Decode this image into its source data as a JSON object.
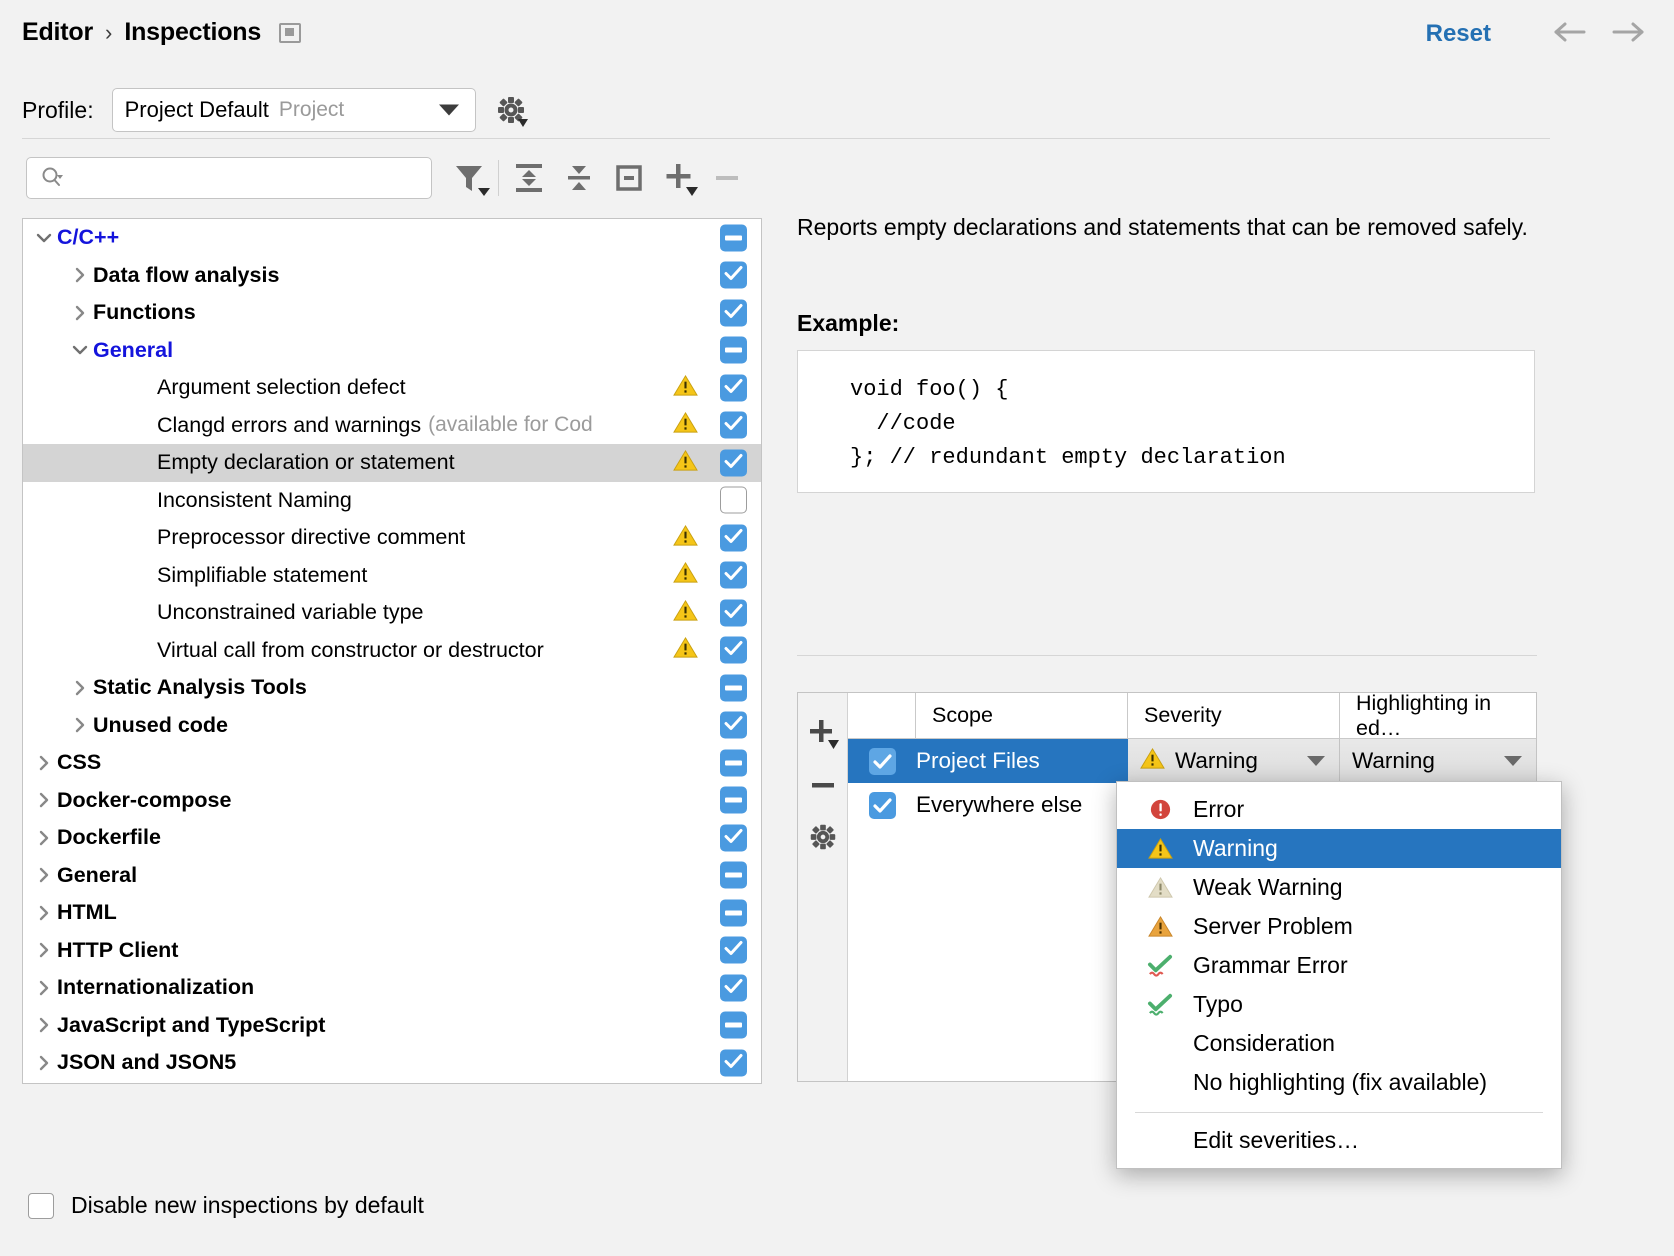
{
  "header": {
    "breadcrumb": [
      "Editor",
      "Inspections"
    ],
    "separator": "›",
    "reset_label": "Reset",
    "back_icon": "arrow-left-icon",
    "forward_icon": "arrow-right-icon",
    "settings_badge_icon": "window-panel-icon"
  },
  "profile": {
    "label": "Profile:",
    "value": "Project Default",
    "suffix": "Project",
    "gear_icon": "gear-dropdown-icon"
  },
  "search": {
    "placeholder": "",
    "value": "",
    "icon": "search-icon"
  },
  "toolbar": [
    {
      "name": "filter-icon",
      "tooltip": "Filter inspections"
    },
    {
      "name": "expand-all-icon",
      "tooltip": "Expand all"
    },
    {
      "name": "collapse-all-icon",
      "tooltip": "Collapse all"
    },
    {
      "name": "expand-selection-icon",
      "tooltip": "Expand selection"
    },
    {
      "name": "add-icon",
      "tooltip": "Add"
    },
    {
      "name": "remove-icon",
      "tooltip": "Remove"
    }
  ],
  "tree": {
    "rows": [
      {
        "label": "C/C++",
        "indent": 0,
        "twisty": "down",
        "style": "blue",
        "check": "partial",
        "warn": false
      },
      {
        "label": "Data flow analysis",
        "indent": 1,
        "twisty": "right",
        "style": "group",
        "check": "on",
        "warn": false
      },
      {
        "label": "Functions",
        "indent": 1,
        "twisty": "right",
        "style": "group",
        "check": "on",
        "warn": false
      },
      {
        "label": "General",
        "indent": 1,
        "twisty": "down",
        "style": "blue",
        "check": "partial",
        "warn": false
      },
      {
        "label": "Argument selection defect",
        "indent": 2,
        "twisty": "none",
        "style": "leaf",
        "check": "on",
        "warn": true
      },
      {
        "label": "Clangd errors and warnings",
        "sub": "(available for Cod",
        "indent": 2,
        "twisty": "none",
        "style": "leaf",
        "check": "on",
        "warn": true
      },
      {
        "label": "Empty declaration or statement",
        "indent": 2,
        "twisty": "none",
        "style": "leaf",
        "check": "on",
        "warn": true,
        "selected": true
      },
      {
        "label": "Inconsistent Naming",
        "indent": 2,
        "twisty": "none",
        "style": "leaf",
        "check": "off",
        "warn": false
      },
      {
        "label": "Preprocessor directive comment",
        "indent": 2,
        "twisty": "none",
        "style": "leaf",
        "check": "on",
        "warn": true
      },
      {
        "label": "Simplifiable statement",
        "indent": 2,
        "twisty": "none",
        "style": "leaf",
        "check": "on",
        "warn": true
      },
      {
        "label": "Unconstrained variable type",
        "indent": 2,
        "twisty": "none",
        "style": "leaf",
        "check": "on",
        "warn": true
      },
      {
        "label": "Virtual call from constructor or destructor",
        "indent": 2,
        "twisty": "none",
        "style": "leaf",
        "check": "on",
        "warn": true
      },
      {
        "label": "Static Analysis Tools",
        "indent": 1,
        "twisty": "right",
        "style": "group",
        "check": "partial",
        "warn": false
      },
      {
        "label": "Unused code",
        "indent": 1,
        "twisty": "right",
        "style": "group",
        "check": "on",
        "warn": false
      },
      {
        "label": "CSS",
        "indent": 0,
        "twisty": "right",
        "style": "group",
        "check": "partial",
        "warn": false
      },
      {
        "label": "Docker-compose",
        "indent": 0,
        "twisty": "right",
        "style": "group",
        "check": "partial",
        "warn": false
      },
      {
        "label": "Dockerfile",
        "indent": 0,
        "twisty": "right",
        "style": "group",
        "check": "on",
        "warn": false
      },
      {
        "label": "General",
        "indent": 0,
        "twisty": "right",
        "style": "group",
        "check": "partial",
        "warn": false
      },
      {
        "label": "HTML",
        "indent": 0,
        "twisty": "right",
        "style": "group",
        "check": "partial",
        "warn": false
      },
      {
        "label": "HTTP Client",
        "indent": 0,
        "twisty": "right",
        "style": "group",
        "check": "on",
        "warn": false
      },
      {
        "label": "Internationalization",
        "indent": 0,
        "twisty": "right",
        "style": "group",
        "check": "on",
        "warn": false
      },
      {
        "label": "JavaScript and TypeScript",
        "indent": 0,
        "twisty": "right",
        "style": "group",
        "check": "partial",
        "warn": false
      },
      {
        "label": "JSON and JSON5",
        "indent": 0,
        "twisty": "right",
        "style": "group",
        "check": "on",
        "warn": false
      },
      {
        "label": "",
        "indent": 0,
        "twisty": "right",
        "style": "group",
        "check": "partial",
        "warn": false
      }
    ]
  },
  "bottom": {
    "disable_new_label": "Disable new inspections by default",
    "disable_new_checked": false
  },
  "detail": {
    "description": "Reports empty declarations and statements that can be removed safely.",
    "example_label": "Example:",
    "code": "void foo() {\n  //code\n}; // redundant empty declaration"
  },
  "scope_table": {
    "toolbar": [
      {
        "name": "add-scope-icon"
      },
      {
        "name": "remove-scope-icon"
      },
      {
        "name": "scope-settings-gear-icon"
      }
    ],
    "columns": [
      "",
      "Scope",
      "Severity",
      "Highlighting in ed…"
    ],
    "rows": [
      {
        "checked": true,
        "scope": "Project Files",
        "severity": "Warning",
        "severity_icon": "warning-triangle-icon",
        "highlighting": "Warning",
        "selected": true
      },
      {
        "checked": true,
        "scope": "Everywhere else",
        "severity": "",
        "severity_icon": "",
        "highlighting": "",
        "selected": false
      }
    ]
  },
  "severity_menu": {
    "items": [
      {
        "label": "Error",
        "icon": "error-circle-icon",
        "highlighted": false
      },
      {
        "label": "Warning",
        "icon": "warning-triangle-icon",
        "highlighted": true
      },
      {
        "label": "Weak Warning",
        "icon": "weak-warning-triangle-icon",
        "highlighted": false
      },
      {
        "label": "Server Problem",
        "icon": "server-problem-triangle-icon",
        "highlighted": false
      },
      {
        "label": "Grammar Error",
        "icon": "grammar-check-icon",
        "highlighted": false
      },
      {
        "label": "Typo",
        "icon": "typo-check-icon",
        "highlighted": false
      },
      {
        "label": "Consideration",
        "icon": "",
        "highlighted": false
      },
      {
        "label": "No highlighting (fix available)",
        "icon": "",
        "highlighted": false
      }
    ],
    "footer": {
      "label": "Edit severities…"
    }
  },
  "colors": {
    "accent_blue": "#2675bf",
    "link_blue": "#2470b3",
    "tree_blue": "#1414dc",
    "checkbox_blue": "#4a9ae0",
    "warning_yellow": "#f5c518",
    "error_red": "#d2453c",
    "server_orange": "#e8a33d",
    "grammar_green": "#4caf6d",
    "panel_bg": "#f2f2f2"
  }
}
